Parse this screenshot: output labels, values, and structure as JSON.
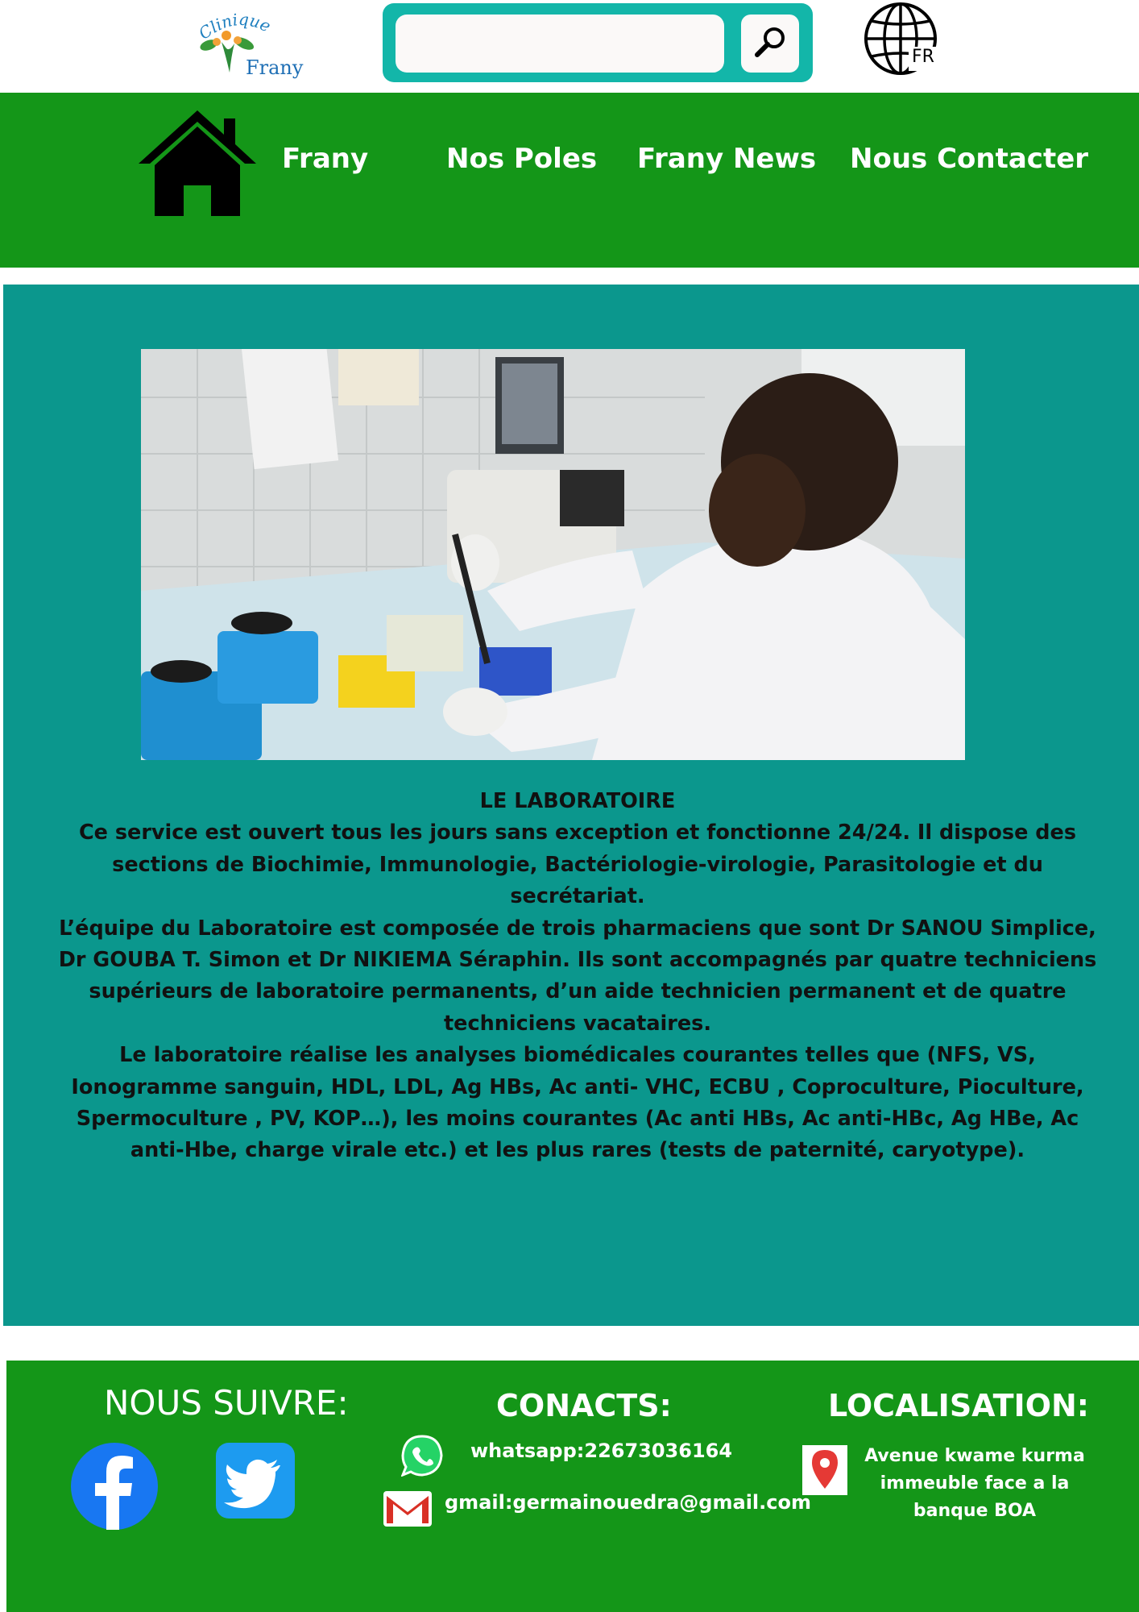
{
  "header": {
    "logo": {
      "line1": "Clinique",
      "line2": "Frany"
    },
    "search": {
      "placeholder": ""
    },
    "language": {
      "code": "FR"
    }
  },
  "nav": {
    "items": [
      {
        "label": "Frany"
      },
      {
        "label": "Nos Poles"
      },
      {
        "label": "Frany News"
      },
      {
        "label": "Nous Contacter"
      }
    ]
  },
  "article": {
    "title": "LE LABORATOIRE",
    "paragraphs": [
      "Ce service est ouvert tous les jours sans exception et fonctionne 24/24. Il dispose des sections de Biochimie, Immunologie, Bactériologie-virologie, Parasitologie et du secrétariat.",
      "L’équipe du Laboratoire est composée de trois pharmaciens que sont Dr SANOU Simplice, Dr  GOUBA T. Simon et Dr NIKIEMA Séraphin. Ils sont accompagnés par quatre techniciens supérieurs de laboratoire permanents, d’un aide technicien permanent et de quatre techniciens vacataires.",
      "Le laboratoire réalise les analyses biomédicales courantes telles que (NFS, VS, Ionogramme sanguin, HDL, LDL, Ag HBs, Ac anti- VHC, ECBU , Coproculture, Pioculture, Spermoculture , PV, KOP…), les moins courantes (Ac anti HBs, Ac anti-HBc, Ag HBe, Ac anti-Hbe, charge virale etc.) et les plus rares (tests de paternité, caryotype)."
    ]
  },
  "footer": {
    "follow_title": "NOUS SUIVRE:",
    "contacts_title": "CONACTS:",
    "whatsapp": "whatsapp:22673036164",
    "gmail": "gmail:germainouedra@gmail.com",
    "location_title": "LOCALISATION:",
    "address_lines": [
      "Avenue kwame kurma",
      "immeuble face a la",
      "banque BOA"
    ]
  },
  "colors": {
    "nav_green": "#149618",
    "main_teal": "#0b978d",
    "search_teal": "#13b6a9",
    "facebook_blue": "#1877f2",
    "twitter_blue": "#1d9bf0",
    "whatsapp_green": "#25d366",
    "pin_red": "#e53935"
  },
  "icons": [
    "search-icon",
    "globe-icon",
    "home-icon",
    "facebook-icon",
    "twitter-icon",
    "whatsapp-icon",
    "gmail-icon",
    "location-pin-icon"
  ]
}
